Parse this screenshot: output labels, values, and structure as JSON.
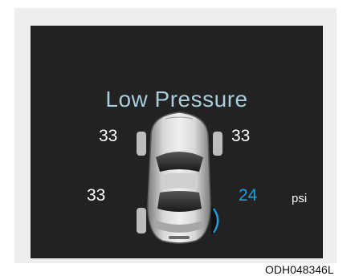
{
  "display": {
    "title": "Low Pressure",
    "tires": {
      "front_left": "33",
      "front_right": "33",
      "rear_left": "33",
      "rear_right": "24"
    },
    "unit": "psi",
    "alert_tire": "rear_right",
    "alert_color": "#1e9ee0",
    "title_color": "#a8ccdc",
    "screen_color": "#222222"
  },
  "caption": "ODH048346L"
}
